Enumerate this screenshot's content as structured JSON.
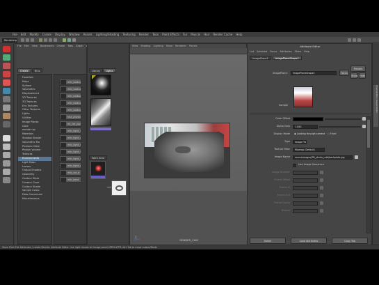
{
  "menubar": [
    "File",
    "Edit",
    "Modify",
    "Create",
    "Display",
    "Window",
    "Assets",
    "Lighting/Shading",
    "Texturing",
    "Render",
    "Toon",
    "Paint Effects",
    "Fur",
    "Muscle",
    "Hair",
    "Render Cache",
    "Help"
  ],
  "menuset": "Rendering",
  "hypershade": {
    "menu": [
      "File",
      "Edit",
      "View",
      "Bookmarks",
      "Create",
      "Tabs",
      "Graph",
      "Window"
    ],
    "tabs": {
      "create": "Create",
      "bins": "Bins",
      "library": "Library",
      "lights": "Lights",
      "work_area": "Work Area"
    },
    "outliner_items": [
      {
        "label": "Favorites",
        "selected": false
      },
      {
        "label": "Maya",
        "selected": false
      },
      {
        "label": "Surface",
        "selected": false
      },
      {
        "label": "Volumetric",
        "selected": false
      },
      {
        "label": "Displacement",
        "selected": false
      },
      {
        "label": "2D Textures",
        "selected": false
      },
      {
        "label": "3D Textures",
        "selected": false
      },
      {
        "label": "Env Textures",
        "selected": false
      },
      {
        "label": "Other Textures",
        "selected": false
      },
      {
        "label": "Lights",
        "selected": false
      },
      {
        "label": "Utilities",
        "selected": false
      },
      {
        "label": "Image Planes",
        "selected": false
      },
      {
        "label": "Glow",
        "selected": false
      },
      {
        "label": "mental ray",
        "selected": false
      },
      {
        "label": "Materials",
        "selected": false
      },
      {
        "label": "Shadow Shader",
        "selected": false
      },
      {
        "label": "Volumetric Ma",
        "selected": false
      },
      {
        "label": "Photonic Mate",
        "selected": false
      },
      {
        "label": "Photon Volume",
        "selected": false
      },
      {
        "label": "Textures",
        "selected": false
      },
      {
        "label": "Environments",
        "selected": true
      },
      {
        "label": "Light Maps",
        "selected": false
      },
      {
        "label": "Lenses",
        "selected": false
      },
      {
        "label": "Output Shaders",
        "selected": false
      },
      {
        "label": "Geometry",
        "selected": false
      },
      {
        "label": "Contour Store",
        "selected": false
      },
      {
        "label": "Contour Contr",
        "selected": false
      },
      {
        "label": "Contour Shade",
        "selected": false
      },
      {
        "label": "Sample Comp",
        "selected": false
      },
      {
        "label": "Data Conversion",
        "selected": false
      },
      {
        "label": "Miscellaneous",
        "selected": false
      }
    ],
    "nodes": [
      "mib_lookup_b",
      "mib_lookup_s",
      "mib_lookup_c",
      "mib_lookup_sph",
      "mib_lookup_cyl",
      "mia_physicalsky",
      "mi_car_paint",
      "mib_light_l",
      "mib_light_p",
      "mib_light_s",
      "mib_light_i",
      "mib_light_a",
      "mib_light_ph",
      "mib_cie_d",
      "mib_bent"
    ]
  },
  "viewport": {
    "menu": [
      "View",
      "Shading",
      "Lighting",
      "Show",
      "Renderer",
      "Panels"
    ],
    "camera": "RENDER_CAM",
    "header": "RENDER CAM"
  },
  "attribute_editor": {
    "title": "Attribute Editor",
    "menu": [
      "List",
      "Selected",
      "Focus",
      "Attributes",
      "Show",
      "Help"
    ],
    "tabs": [
      "imagePlane1",
      "imagePlaneShape1"
    ],
    "node_type_label": "imagePlane:",
    "node_name": "imagePlaneShape1",
    "focus_button": "Focus",
    "presets_button": "Presets",
    "show_button": "Show",
    "hide_button": "Hide",
    "sample_label": "Sample",
    "attributes": [
      {
        "label": "Color Offset",
        "value": "",
        "dim": false
      },
      {
        "label": "Alpha Gain",
        "value": "1.000",
        "dim": false
      },
      {
        "label": "Display Mode",
        "value": "Attached to Camera",
        "dim": false
      },
      {
        "label": "Type",
        "value": "Image File",
        "dim": false
      },
      {
        "label": "Texture Filter",
        "value": "Mipmap (Default)",
        "dim": false
      },
      {
        "label": "Image Name",
        "value": "sourceimages/3D_photo_mtd/backplate.jpg",
        "dim": false
      },
      {
        "label": "",
        "value": "Use Image Sequence",
        "dim": false
      },
      {
        "label": "Image Number",
        "value": "",
        "dim": true
      },
      {
        "label": "Frame Offset",
        "value": "",
        "dim": true
      },
      {
        "label": "Frame In",
        "value": "",
        "dim": true
      },
      {
        "label": "Frame Out",
        "value": "",
        "dim": true
      },
      {
        "label": "Frame Cache",
        "value": "",
        "dim": true
      },
      {
        "label": "Texture",
        "value": "",
        "dim": true
      }
    ],
    "fixed_label": "Fixed",
    "looking_label": "Looking through camera",
    "bottom_buttons": [
      "Select",
      "Load Attributes",
      "Copy Tab"
    ]
  },
  "side_tab": "Channel Box / Layer Editor",
  "statusbar": "Show Plain File Attributes / create Bind to: Attribute Editor. Use right mouse for image panel OPEN ATTR. Alt+Tab to move output/Mode."
}
